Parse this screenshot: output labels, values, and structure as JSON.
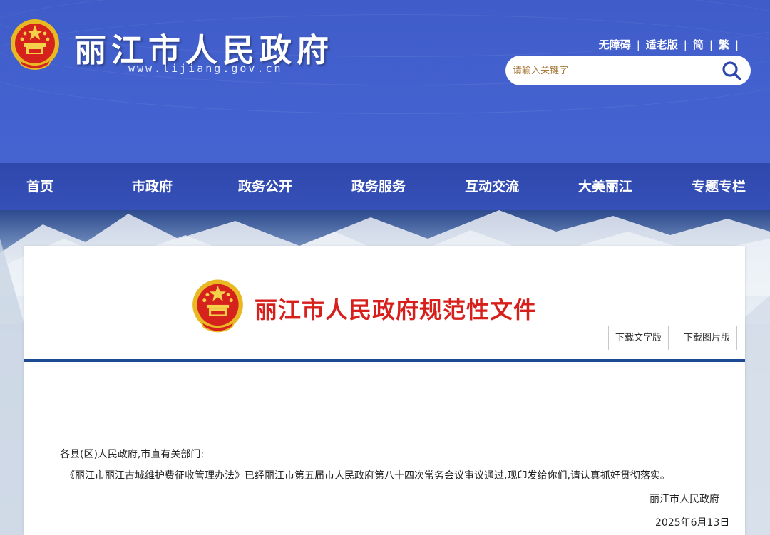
{
  "header": {
    "site_title": "丽江市人民政府",
    "site_url": "www.lijiang.gov.cn",
    "links": [
      "无障碍",
      "适老版",
      "简",
      "繁"
    ],
    "separator": "|",
    "search": {
      "placeholder": "请输入关键字"
    },
    "colors": {
      "header_bg": "#4462cf",
      "nav_bg": "#3550b8"
    }
  },
  "nav": {
    "items": [
      {
        "label": "首页"
      },
      {
        "label": "市政府"
      },
      {
        "label": "政务公开"
      },
      {
        "label": "政务服务"
      },
      {
        "label": "互动交流"
      },
      {
        "label": "大美丽江"
      },
      {
        "label": "专题专栏"
      }
    ]
  },
  "document": {
    "banner_title": "丽江市人民政府规范性文件",
    "title_color": "#d7201c",
    "download_text_label": "下载文字版",
    "download_image_label": "下载图片版",
    "salutation": "各县(区)人民政府,市直有关部门:",
    "body": "《丽江市丽江古城维护费征收管理办法》已经丽江市第五届市人民政府第八十四次常务会议审议通过,现印发给你们,请认真抓好贯彻落实。",
    "signature": "丽江市人民政府",
    "date": "2025年6月13日"
  }
}
